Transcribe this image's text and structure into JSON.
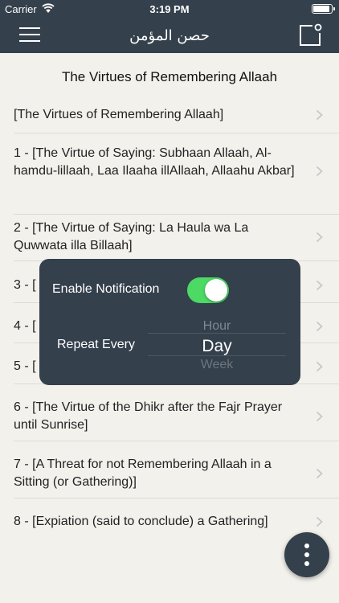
{
  "status_bar": {
    "carrier": "Carrier",
    "time": "3:19 PM",
    "battery_level": 1.0
  },
  "nav": {
    "title": "حصن المؤمن",
    "menu_icon": "hamburger-menu-icon",
    "right_icon": "note-icon"
  },
  "page_heading": "The Virtues of Remembering Allaah",
  "items": [
    {
      "text": "[The Virtues of Remembering Allaah]"
    },
    {
      "text": "1 - [The Virtue of Saying: Subhaan Allaah, Al-hamdu-lillaah, Laa Ilaaha illAllaah, Allaahu Akbar]"
    },
    {
      "text": "2 - [The Virtue of Saying: La Haula wa La Quwwata illa Billaah]"
    },
    {
      "text": "3 - ["
    },
    {
      "text": "4 - ["
    },
    {
      "text": "5 - ["
    },
    {
      "text": "6 - [The Virtue of the Dhikr after the Fajr Prayer until Sunrise]"
    },
    {
      "text": "7 - [A Threat for not Remembering Allaah in a Sitting (or Gathering)]"
    },
    {
      "text": "8 - [Expiation (said to conclude) a Gathering]"
    }
  ],
  "popup": {
    "enable_label": "Enable Notification",
    "enabled": true,
    "repeat_label": "Repeat Every",
    "picker_options": {
      "previous": "Hour",
      "selected": "Day",
      "next": "Week"
    }
  },
  "colors": {
    "nav": "#34404c",
    "toggle_on": "#4cd964",
    "background": "#f3f1ec"
  }
}
